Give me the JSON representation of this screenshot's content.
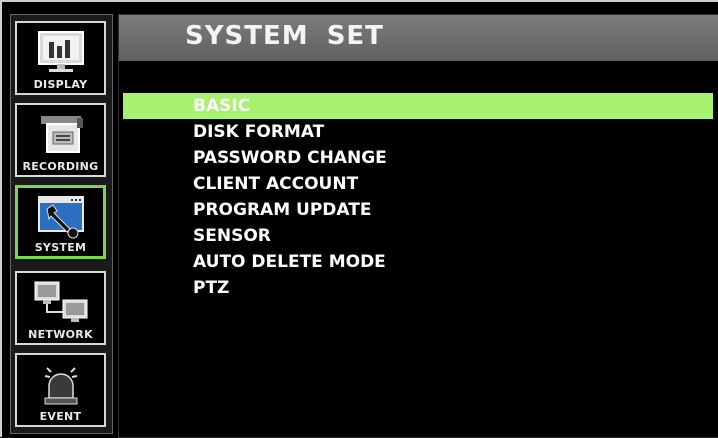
{
  "sidebar": {
    "items": [
      {
        "label": "DISPLAY",
        "icon": "display-icon",
        "active": false
      },
      {
        "label": "RECORDING",
        "icon": "camera-icon",
        "active": false
      },
      {
        "label": "SYSTEM",
        "icon": "wrench-icon",
        "active": true
      },
      {
        "label": "NETWORK",
        "icon": "network-icon",
        "active": false
      },
      {
        "label": "EVENT",
        "icon": "siren-icon",
        "active": false
      }
    ]
  },
  "main": {
    "title": "SYSTEM  SET",
    "menu": [
      {
        "label": "BASIC",
        "selected": true
      },
      {
        "label": "DISK FORMAT"
      },
      {
        "label": "PASSWORD CHANGE"
      },
      {
        "label": "CLIENT ACCOUNT"
      },
      {
        "label": "PROGRAM UPDATE"
      },
      {
        "label": "SENSOR"
      },
      {
        "label": "AUTO DELETE MODE"
      },
      {
        "label": "PTZ"
      }
    ]
  },
  "colors": {
    "accent": "#a7f26f",
    "active_border": "#7cd64a",
    "title_bar": "#6e6e6e"
  }
}
